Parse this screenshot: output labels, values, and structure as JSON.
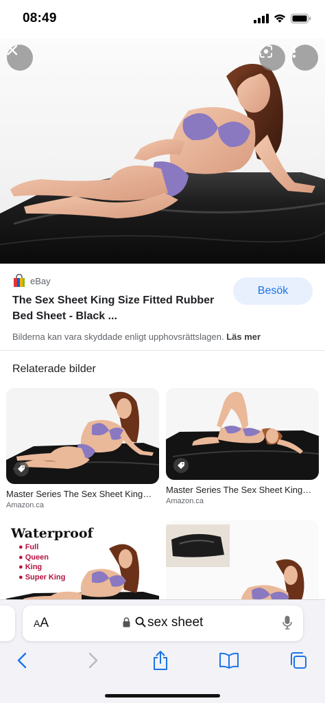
{
  "status_bar": {
    "time": "08:49"
  },
  "hero": {
    "close_icon": "close-icon",
    "lens_icon": "lens-icon",
    "more_icon": "more-vertical-icon"
  },
  "result": {
    "source_name": "eBay",
    "title": "The Sex Sheet King Size Fitted Rubber Bed Sheet - Black ...",
    "visit_label": "Besök",
    "copyright_notice": "Bilderna kan vara skyddade enligt upphovsrättslagen.",
    "learn_more": "Läs mer"
  },
  "related": {
    "heading": "Relaterade bilder",
    "items": [
      {
        "title": "Master Series The Sex Sheet King…",
        "source": "Amazon.ca"
      },
      {
        "title": "Master Series The Sex Sheet King…",
        "source": "Amazon.ca"
      },
      {
        "overlay_title": "Waterproof",
        "overlay_list": [
          "Full",
          "Queen",
          "King",
          "Super King"
        ]
      },
      {}
    ]
  },
  "safari": {
    "text_size_label_small": "A",
    "text_size_label_large": "A",
    "address": "sex sheet"
  },
  "colors": {
    "accent": "#1a73e8",
    "visit_bg": "#e8f0fe",
    "sheet_black": "#151515",
    "lingerie": "#8a78c0"
  }
}
